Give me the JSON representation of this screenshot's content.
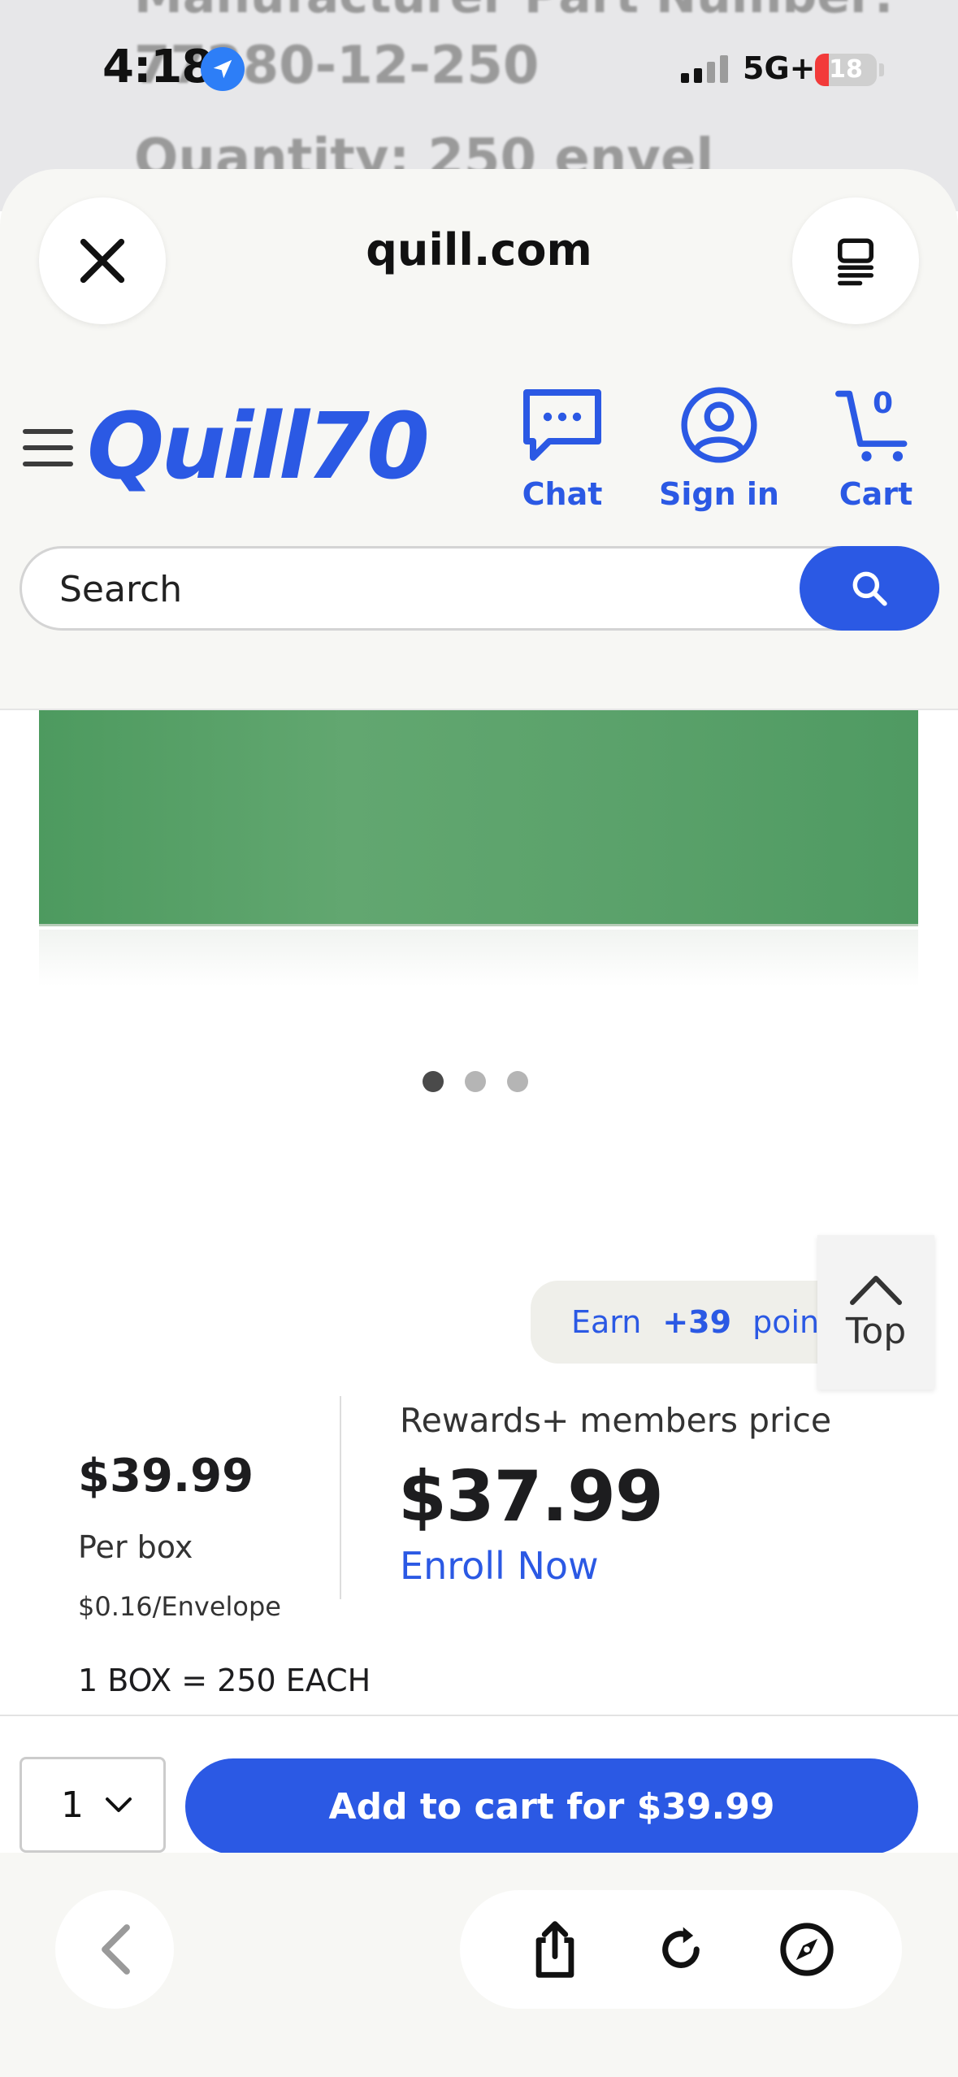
{
  "background_page": {
    "line1": "Manufacturer Part Number:",
    "line2": "77280-12-250",
    "line3": "Quantity: 250 envel"
  },
  "status_bar": {
    "time": "4:18",
    "network": "5G+",
    "battery_level": "18"
  },
  "browser": {
    "domain": "quill.com"
  },
  "header": {
    "logo_text": "Quill70",
    "chat_label": "Chat",
    "sign_in_label": "Sign in",
    "cart_label": "Cart",
    "cart_count": "0"
  },
  "search": {
    "placeholder": "Search"
  },
  "gallery": {
    "slide_count": 3,
    "active_slide": 1
  },
  "rewards": {
    "earn_label": "Earn",
    "points": "+39",
    "points_label": "points"
  },
  "top_button": {
    "label": "Top"
  },
  "pricing": {
    "price": "$39.99",
    "per_box": "Per box",
    "per_unit": "$0.16/Envelope",
    "members_label": "Rewards+ members price",
    "members_price": "$37.99",
    "enroll_label": "Enroll Now",
    "box_quantity": "1 BOX = 250 EACH"
  },
  "cart_bar": {
    "quantity": "1",
    "add_button": "Add to cart for $39.99"
  },
  "colors": {
    "brand_blue": "#2b59e4",
    "sheet_bg": "#f7f7f4",
    "location_blue": "#2d7ef7",
    "battery_red": "#f23a3a"
  }
}
